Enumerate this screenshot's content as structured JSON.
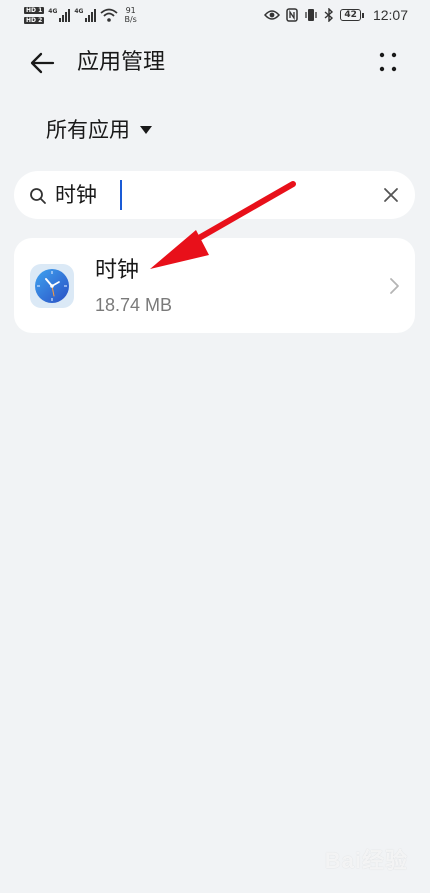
{
  "status_bar": {
    "sim1_label": "HD 1",
    "sim2_label": "HD 2",
    "net1": "4G",
    "net2": "4G",
    "speed_value": "91",
    "speed_unit": "B/s",
    "battery": "42",
    "time": "12:07",
    "icons": [
      "eye-icon",
      "nfc-icon",
      "vibrate-icon",
      "bluetooth-icon",
      "battery-icon"
    ]
  },
  "header": {
    "title": "应用管理",
    "back_icon": "arrow-left-icon",
    "more_icon": "more-vertical-icon"
  },
  "filter": {
    "label": "所有应用",
    "icon": "dropdown-triangle-icon"
  },
  "search": {
    "value": "时钟",
    "icon": "search-icon",
    "clear_icon": "close-icon"
  },
  "results": [
    {
      "name": "时钟",
      "size": "18.74 MB",
      "icon": "clock-app-icon"
    }
  ],
  "annotation": {
    "color": "#e8101a"
  },
  "watermark": {
    "text": "Bai经验"
  }
}
